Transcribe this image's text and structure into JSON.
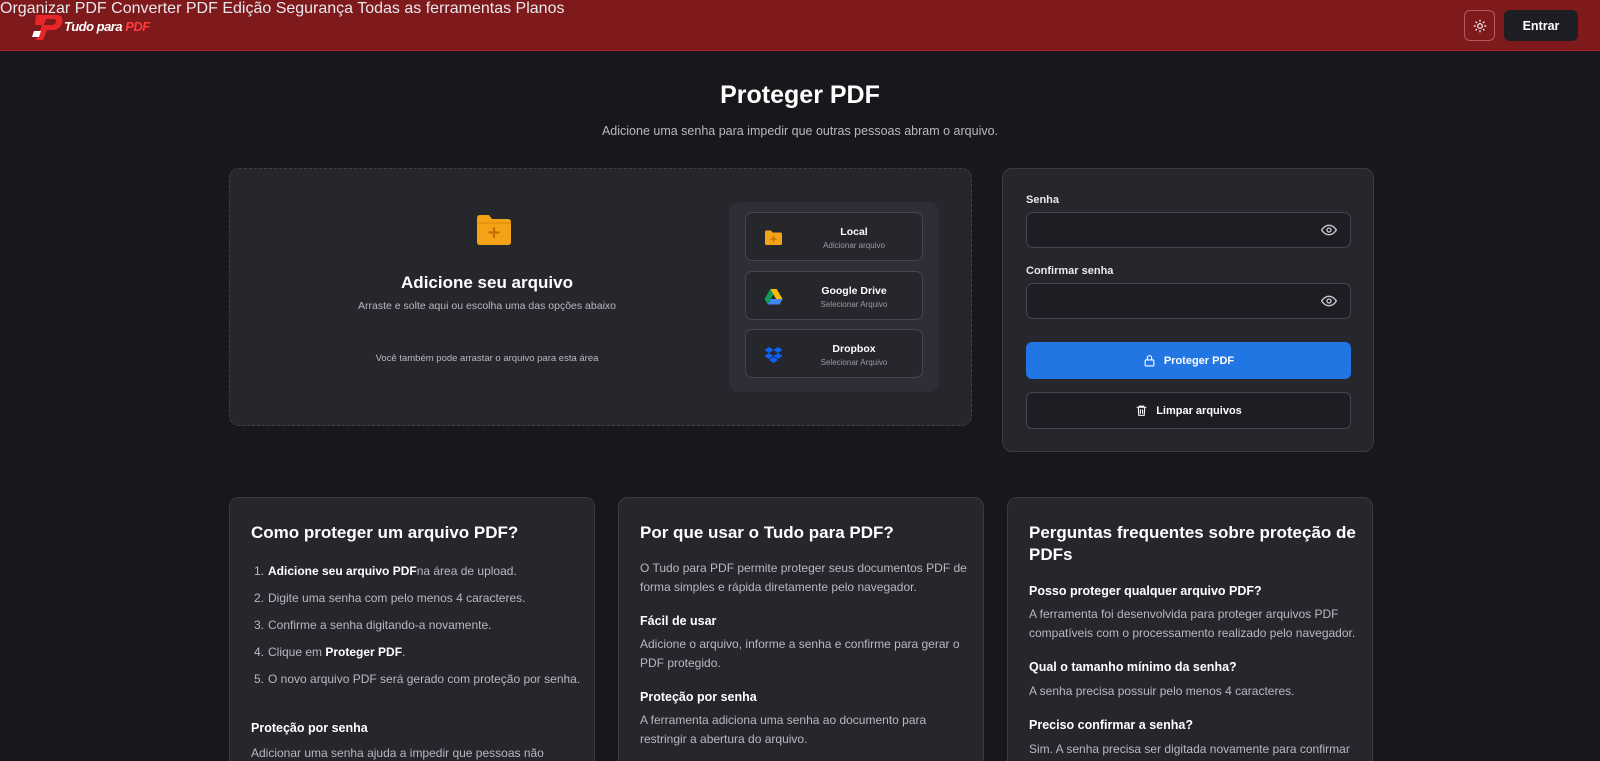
{
  "header": {
    "logo_text": "Tudo para ",
    "logo_text_accent": "PDF",
    "nav": [
      "Organizar PDF",
      "Converter PDF",
      "Edição",
      "Segurança",
      "Todas as ferramentas",
      "Planos"
    ],
    "theme_icon": "sun-icon",
    "login_label": "Entrar"
  },
  "page": {
    "title": "Proteger PDF",
    "subtitle": "Adicione uma senha para impedir que outras pessoas abram o arquivo."
  },
  "upload": {
    "title": "Adicione seu arquivo",
    "subtitle": "Arraste e solte aqui ou escolha uma das opções abaixo",
    "hint": "Você também pode arrastar o arquivo para esta área",
    "sources": [
      {
        "name": "Local",
        "desc": "Adicionar arquivo",
        "icon": "folder-icon"
      },
      {
        "name": "Google Drive",
        "desc": "Selecionar Arquivo",
        "icon": "google-drive-icon"
      },
      {
        "name": "Dropbox",
        "desc": "Selecionar Arquivo",
        "icon": "dropbox-icon"
      }
    ]
  },
  "password": {
    "label": "Senha",
    "value": "",
    "confirm_label": "Confirmar senha",
    "confirm_value": "",
    "protect_label": "Proteger PDF",
    "clear_label": "Limpar arquivos"
  },
  "info": {
    "how": {
      "title": "Como proteger um arquivo PDF?",
      "steps": [
        {
          "num": "1.",
          "bold": "Adicione seu arquivo PDF",
          "text": "na área de upload."
        },
        {
          "num": "2.",
          "text": "Digite uma senha com pelo menos 4 caracteres."
        },
        {
          "num": "3.",
          "text": "Confirme a senha digitando-a novamente."
        },
        {
          "num": "4.",
          "text": "Clique em ",
          "bold": "Proteger PDF",
          "after": "."
        },
        {
          "num": "5.",
          "text": "O novo arquivo PDF será gerado com proteção por senha."
        }
      ],
      "sub_title": "Proteção por senha",
      "sub_text": "Adicionar uma senha ajuda a impedir que pessoas não"
    },
    "why": {
      "title": "Por que usar o Tudo para PDF?",
      "intro": "O Tudo para PDF permite proteger seus documentos PDF de forma simples e rápida diretamente pelo navegador.",
      "sections": [
        {
          "title": "Fácil de usar",
          "text": "Adicione o arquivo, informe a senha e confirme para gerar o PDF protegido."
        },
        {
          "title": "Proteção por senha",
          "text": "A ferramenta adiciona uma senha ao documento para restringir a abertura do arquivo."
        }
      ]
    },
    "faq": {
      "title": "Perguntas frequentes sobre proteção de PDFs",
      "items": [
        {
          "q": "Posso proteger qualquer arquivo PDF?",
          "a": "A ferramenta foi desenvolvida para proteger arquivos PDF compatíveis com o processamento realizado pelo navegador."
        },
        {
          "q": "Qual o tamanho mínimo da senha?",
          "a": "A senha precisa possuir pelo menos 4 caracteres."
        },
        {
          "q": "Preciso confirmar a senha?",
          "a": "Sim. A senha precisa ser digitada novamente para confirmar"
        }
      ]
    }
  },
  "colors": {
    "header_bg": "#7e1a1c",
    "page_bg": "#18181c",
    "card_bg": "#26262d",
    "primary_button": "#2176e3",
    "folder_orange": "#f5a316",
    "logo_accent": "#ff3b3b"
  }
}
